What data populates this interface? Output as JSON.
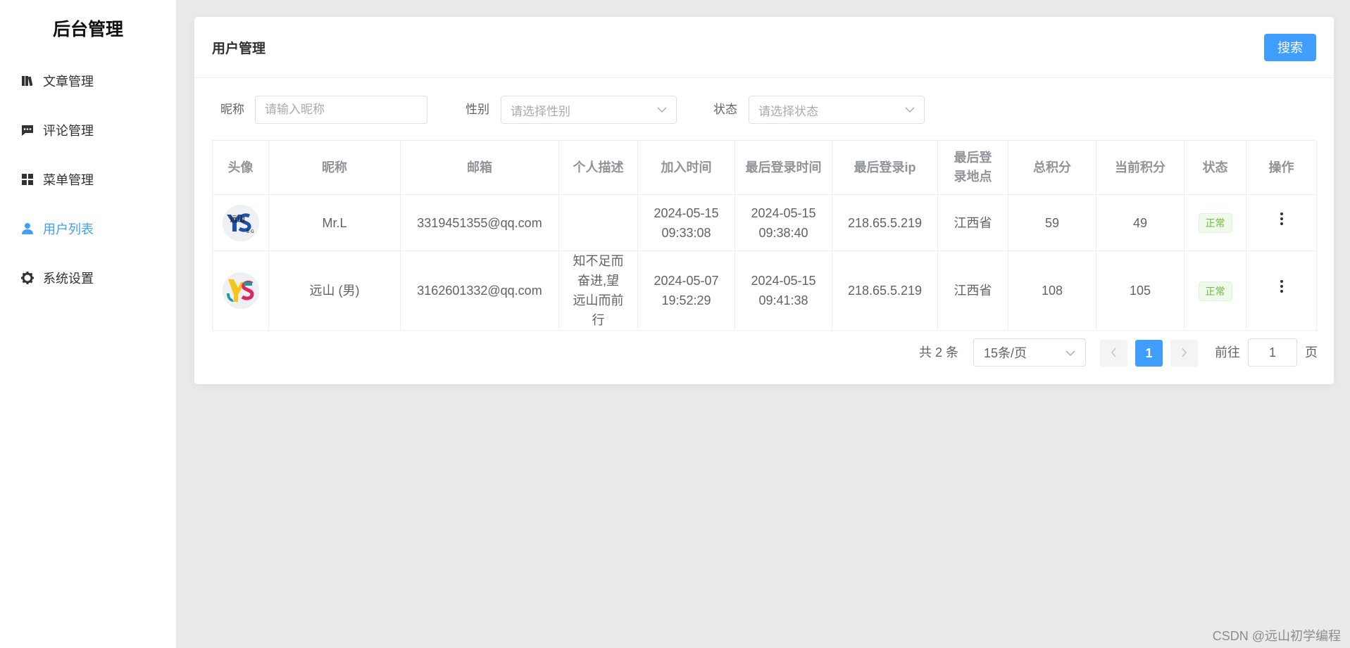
{
  "sidebar": {
    "title": "后台管理",
    "items": [
      {
        "label": "文章管理",
        "icon": "book-icon",
        "active": false
      },
      {
        "label": "评论管理",
        "icon": "comment-icon",
        "active": false
      },
      {
        "label": "菜单管理",
        "icon": "grid-icon",
        "active": false
      },
      {
        "label": "用户列表",
        "icon": "user-icon",
        "active": true
      },
      {
        "label": "系统设置",
        "icon": "gear-icon",
        "active": false
      }
    ]
  },
  "card": {
    "title": "用户管理",
    "search_label": "搜索"
  },
  "filters": {
    "nickname_label": "昵称",
    "nickname_placeholder": "请输入昵称",
    "gender_label": "性别",
    "gender_placeholder": "请选择性别",
    "status_label": "状态",
    "status_placeholder": "请选择状态"
  },
  "table": {
    "headers": [
      "头像",
      "昵称",
      "邮箱",
      "个人描述",
      "加入时间",
      "最后登录时间",
      "最后登录ip",
      "最后登录地点",
      "总积分",
      "当前积分",
      "状态",
      "操作"
    ],
    "rows": [
      {
        "avatar": "avatar-ys-blue",
        "nickname": "Mr.L",
        "email": "3319451355@qq.com",
        "description": "",
        "join_date": "2024-05-15",
        "join_time": "09:33:08",
        "last_login_date": "2024-05-15",
        "last_login_time": "09:38:40",
        "ip": "218.65.5.219",
        "location": "江西省",
        "total_points": "59",
        "current_points": "49",
        "status": "正常"
      },
      {
        "avatar": "avatar-ys-color",
        "nickname": "远山 (男)",
        "email": "3162601332@qq.com",
        "description": "知不足而奋进,望远山而前行",
        "join_date": "2024-05-07",
        "join_time": "19:52:29",
        "last_login_date": "2024-05-15",
        "last_login_time": "09:41:38",
        "ip": "218.65.5.219",
        "location": "江西省",
        "total_points": "108",
        "current_points": "105",
        "status": "正常"
      }
    ]
  },
  "pagination": {
    "total_text": "共 2 条",
    "page_size": "15条/页",
    "current_page": "1",
    "goto_label": "前往",
    "goto_value": "1",
    "page_suffix": "页"
  },
  "watermark": "CSDN @远山初学编程",
  "colors": {
    "primary": "#409eff",
    "success": "#67c23a",
    "background": "#e9eaec"
  }
}
